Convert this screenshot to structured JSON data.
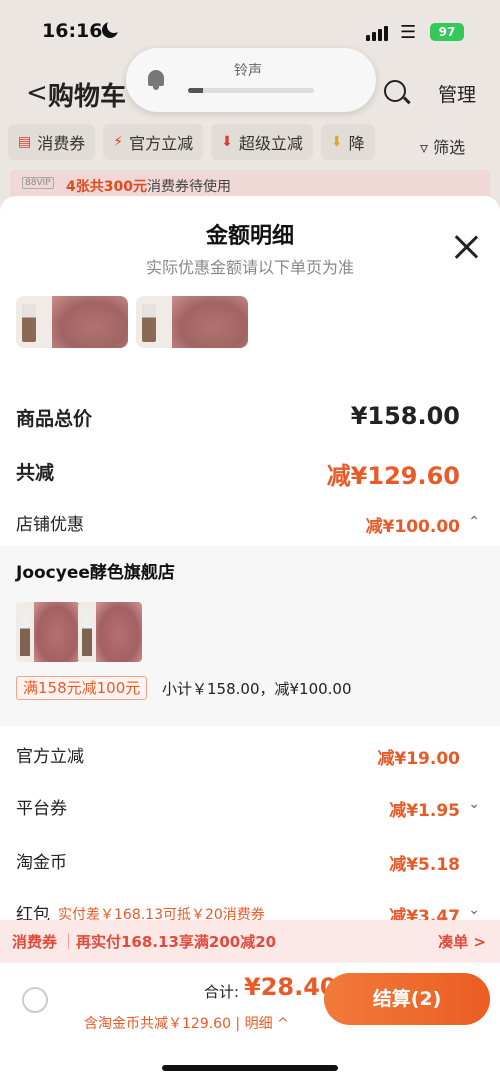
{
  "status_bar": {
    "time": "16:16",
    "battery": "97"
  },
  "cart_header": {
    "back": "<",
    "title": "购物车",
    "manage": "管理"
  },
  "volume_hud": {
    "label": "铃声",
    "level": 0.12
  },
  "chips": [
    {
      "icon": "coupon-icon",
      "label": "消费券"
    },
    {
      "icon": "lightning-icon",
      "label": "官方立减"
    },
    {
      "icon": "down-arrow-icon",
      "label": "超级立减"
    },
    {
      "icon": "down-arrow-icon",
      "label": "降"
    }
  ],
  "filter_label": "筛选",
  "vip_strip": {
    "tag": "88VIP",
    "highlight": "4张共300元",
    "text": "消费券待使用"
  },
  "sheet": {
    "title": "金额明细",
    "subtitle": "实际优惠金额请以下单页为准",
    "goods_total_label": "商品总价",
    "goods_total": "¥158.00",
    "total_off_label": "共减",
    "total_off": "减¥129.60",
    "shop_discount_label": "店铺优惠",
    "shop_discount": "减¥100.00",
    "shop": {
      "name": "Joocyee酵色旗舰店",
      "promo": "满158元减100元",
      "subtotal": "小计￥158.00，减¥100.00"
    },
    "official_label": "官方立减",
    "official": "减¥19.00",
    "platform_label": "平台券",
    "platform": "减¥1.95",
    "taojinbi_label": "淘金币",
    "taojinbi": "减¥5.18",
    "redpacket_label": "红包",
    "redpacket_note": "实付差￥168.13可抵￥20消费券",
    "redpacket": "减¥3.47"
  },
  "coupon_bar": {
    "label": "消费券",
    "text": "再实付168.13享满200减20",
    "link": "凑单 >"
  },
  "footer": {
    "total_label": "合计:",
    "total": "¥28.40",
    "note": "含淘金币共减￥129.60 | 明细 ^",
    "checkout": "结算(2)"
  },
  "colors": {
    "accent": "#e85a28",
    "coupon_red": "#e24a3c"
  }
}
